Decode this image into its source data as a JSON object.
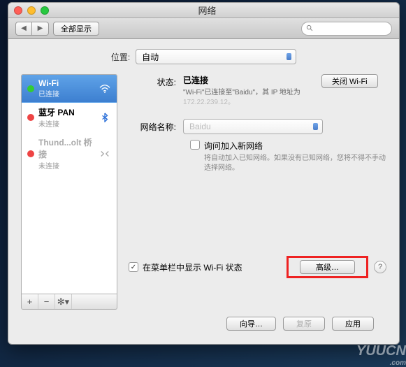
{
  "window": {
    "title": "网络"
  },
  "toolbar": {
    "show_all": "全部显示"
  },
  "location": {
    "label": "位置:",
    "value": "自动"
  },
  "sidebar": {
    "items": [
      {
        "name": "Wi-Fi",
        "status": "已连接",
        "dot": "green",
        "selected": true,
        "icon": "wifi"
      },
      {
        "name": "蓝牙 PAN",
        "status": "未连接",
        "dot": "red",
        "selected": false,
        "icon": "bluetooth"
      },
      {
        "name": "Thund...olt 桥接",
        "status": "未连接",
        "dot": "red",
        "selected": false,
        "icon": "bridge"
      }
    ]
  },
  "detail": {
    "status_label": "状态:",
    "status_value": "已连接",
    "toggle_btn": "关闭 Wi-Fi",
    "status_desc1": "\"Wi-Fi\"已连接至\"Baidu\"，其 IP 地址为",
    "status_desc2": "172.22.239.12。",
    "network_label": "网络名称:",
    "network_value": "Baidu",
    "ask_join": "询问加入新网络",
    "ask_hint": "将自动加入已知网络。如果没有已知网络，您将不得不手动选择网络。",
    "show_menubar": "在菜单栏中显示 Wi-Fi 状态",
    "advanced_btn": "高级…"
  },
  "footer": {
    "assist": "向导…",
    "revert": "复原",
    "apply": "应用"
  },
  "watermark": {
    "main": "YUUCN",
    "sub": ".com"
  }
}
